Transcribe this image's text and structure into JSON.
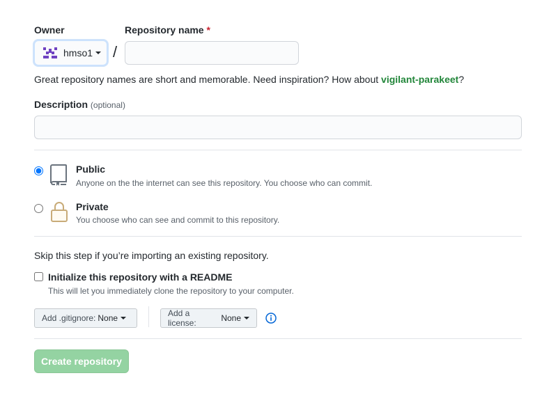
{
  "owner": {
    "label": "Owner",
    "value": "hmso1"
  },
  "repo_name": {
    "label": "Repository name",
    "required_marker": "*",
    "value": "",
    "separator": "/"
  },
  "name_hint": {
    "text": "Great repository names are short and memorable. Need inspiration? How about ",
    "suggestion": "vigilant-parakeet",
    "suffix": "?"
  },
  "description": {
    "label": "Description",
    "optional": "(optional)",
    "value": ""
  },
  "visibility": {
    "selected": "public",
    "public": {
      "title": "Public",
      "desc": "Anyone on the the internet can see this repository. You choose who can commit."
    },
    "private": {
      "title": "Private",
      "desc": "You choose who can see and commit to this repository."
    }
  },
  "init": {
    "skip_text": "Skip this step if you’re importing an existing repository.",
    "readme_label": "Initialize this repository with a README",
    "readme_note": "This will let you immediately clone the repository to your computer.",
    "readme_checked": false
  },
  "gitignore": {
    "label": "Add .gitignore:",
    "value": "None"
  },
  "license": {
    "label": "Add a license:",
    "value": "None"
  },
  "create_button": {
    "label": "Create repository",
    "disabled": true
  },
  "colors": {
    "accent_blue": "#0366d6",
    "suggestion_green": "#22863a",
    "create_disabled_bg": "#94d3a2",
    "required_red": "#cb2431",
    "avatar_purple": "#6f42c1"
  },
  "icons": {
    "public": "repo-book-icon",
    "private": "lock-icon",
    "info": "info-icon",
    "avatar": "owner-avatar-identicon"
  }
}
